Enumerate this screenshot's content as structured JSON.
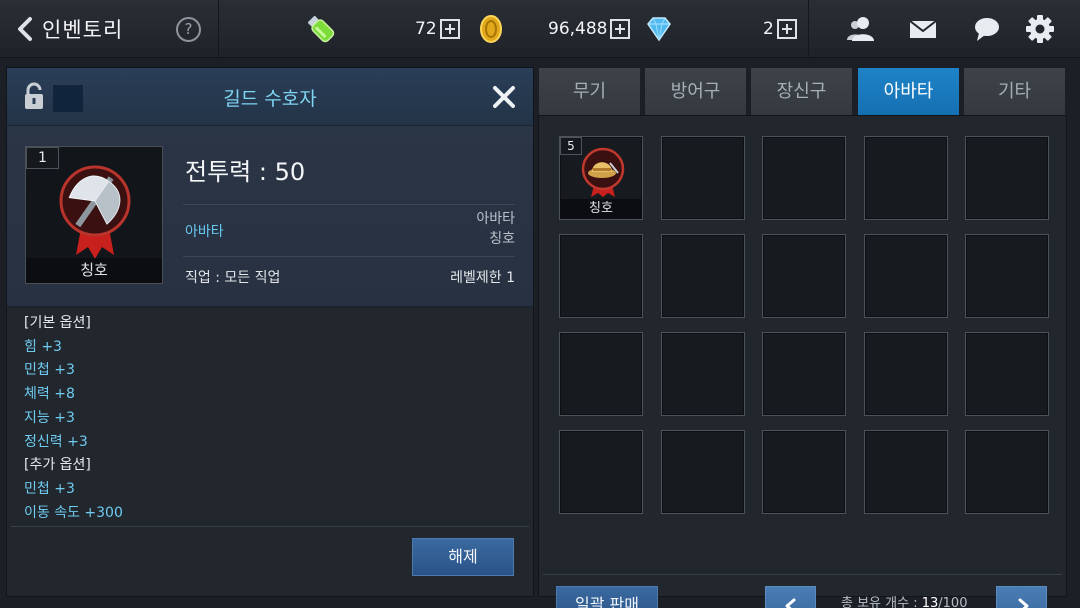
{
  "header": {
    "title": "인벤토리",
    "help_label": "?",
    "currency": {
      "potion": {
        "value": "72",
        "icon": "potion-icon"
      },
      "gold": {
        "value": "96,488",
        "icon": "gold-coin-icon"
      },
      "gem": {
        "value": "2",
        "icon": "diamond-icon"
      }
    },
    "icons": [
      "friends-icon",
      "mail-icon",
      "chat-icon",
      "settings-icon"
    ]
  },
  "detail": {
    "title": "길드 수호자",
    "item": {
      "count": "1",
      "label": "칭호",
      "icon": "axe-title-icon"
    },
    "power_label": "전투력 : 50",
    "type_label": "아바타",
    "category_lines": [
      "아바타",
      "칭호"
    ],
    "job": "직업 : 모든 직업",
    "level_limit": "레벨제한 1",
    "options": [
      {
        "text": "[기본 옵션]",
        "kind": "header"
      },
      {
        "text": "힘 +3",
        "kind": "stat"
      },
      {
        "text": "민첩 +3",
        "kind": "stat"
      },
      {
        "text": "체력 +8",
        "kind": "stat"
      },
      {
        "text": "지능 +3",
        "kind": "stat"
      },
      {
        "text": "정신력 +3",
        "kind": "stat"
      },
      {
        "text": "[추가 옵션]",
        "kind": "header"
      },
      {
        "text": "민첩 +3",
        "kind": "stat"
      },
      {
        "text": "이동 속도 +300",
        "kind": "stat"
      }
    ],
    "release_button": "해제"
  },
  "inventory": {
    "tabs": [
      {
        "label": "무기",
        "active": false
      },
      {
        "label": "방어구",
        "active": false
      },
      {
        "label": "장신구",
        "active": false
      },
      {
        "label": "아바타",
        "active": true
      },
      {
        "label": "기타",
        "active": false
      }
    ],
    "slots": [
      {
        "count": "5",
        "label": "칭호",
        "icon": "hat-title-icon"
      }
    ],
    "empty_slots": 19,
    "sell_all_button": "일괄 판매",
    "count_label": "총 보유 개수 : ",
    "count_current": "13",
    "count_max": "/100"
  },
  "colors": {
    "accent_blue": "#1f83c8",
    "option_text": "#6fcbf0",
    "header_title": "#7fd4f2"
  }
}
